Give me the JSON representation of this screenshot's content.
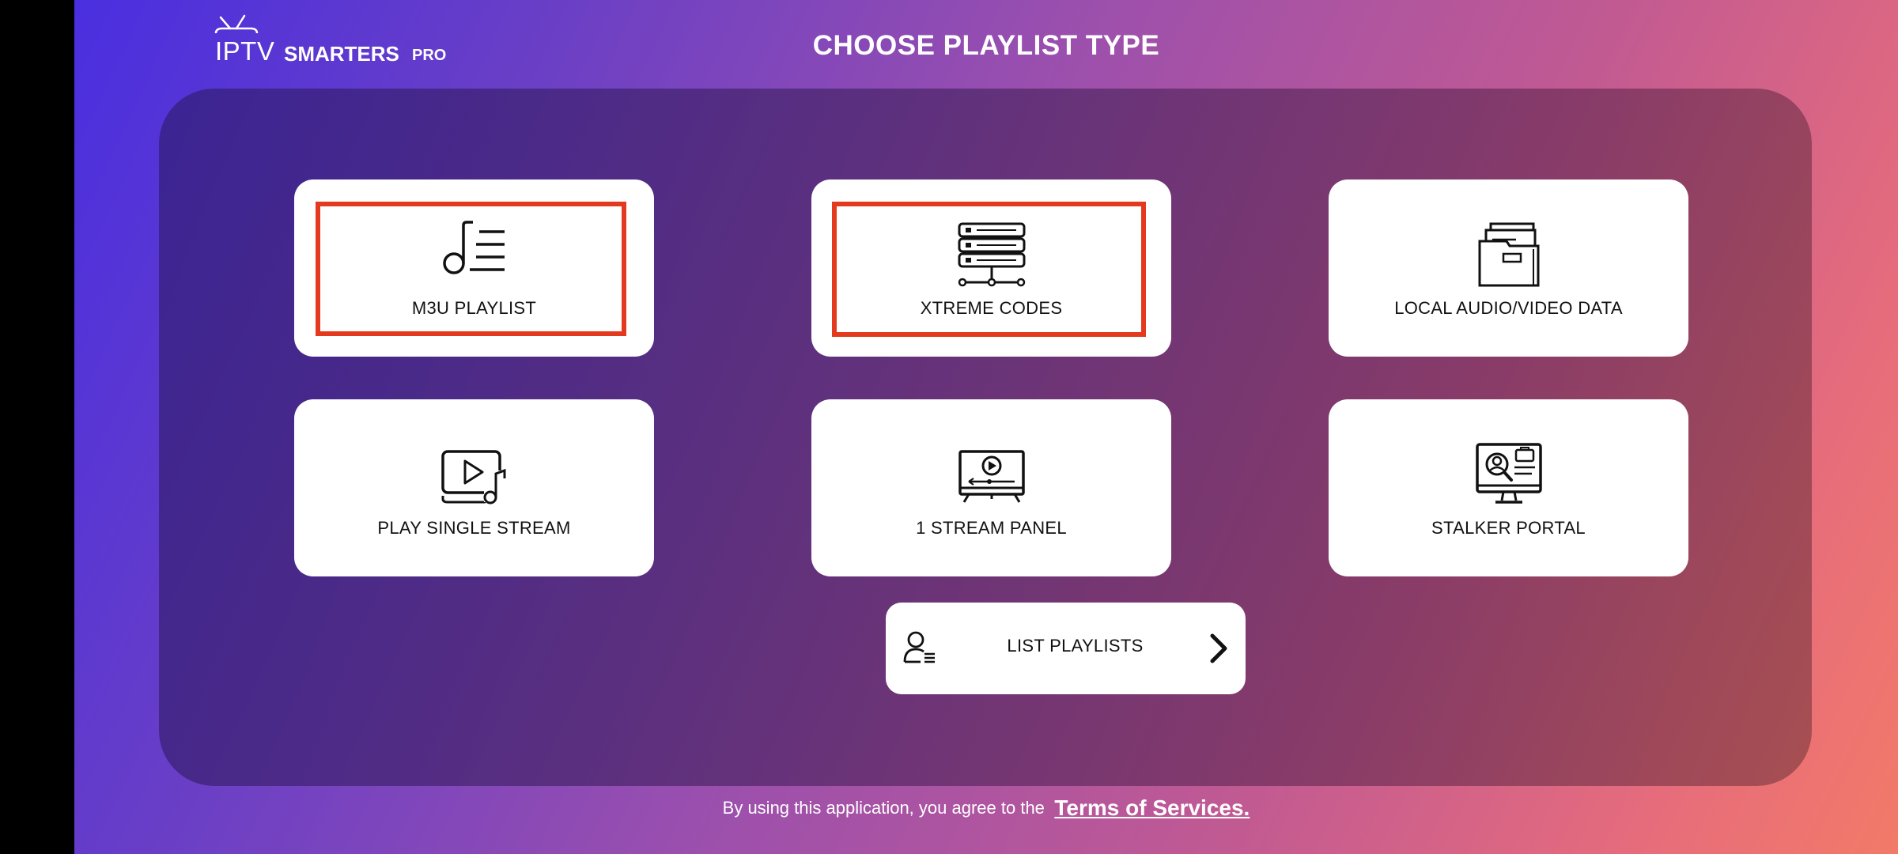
{
  "app": {
    "logo_iptv": "IPTV",
    "logo_smarters": "SMARTERS",
    "logo_pro": "PRO"
  },
  "header": {
    "title": "CHOOSE PLAYLIST TYPE"
  },
  "options": [
    {
      "label": "M3U PLAYLIST",
      "icon": "music-playlist-icon",
      "highlighted": true
    },
    {
      "label": "XTREME CODES",
      "icon": "server-stack-icon",
      "highlighted": true
    },
    {
      "label": "LOCAL AUDIO/VIDEO DATA",
      "icon": "folder-files-icon",
      "highlighted": false
    },
    {
      "label": "PLAY SINGLE STREAM",
      "icon": "video-music-icon",
      "highlighted": false
    },
    {
      "label": "1 STREAM PANEL",
      "icon": "tv-play-icon",
      "highlighted": false
    },
    {
      "label": "STALKER PORTAL",
      "icon": "monitor-search-icon",
      "highlighted": false
    }
  ],
  "list_playlists": {
    "label": "LIST PLAYLISTS",
    "icon": "user-list-icon",
    "chevron": "chevron-right-icon"
  },
  "footer": {
    "agree_text": "By using this application, you agree to the",
    "terms_link": "Terms of Services."
  },
  "colors": {
    "highlight": "#e33a1f",
    "card": "#ffffff",
    "text": "#111111"
  }
}
